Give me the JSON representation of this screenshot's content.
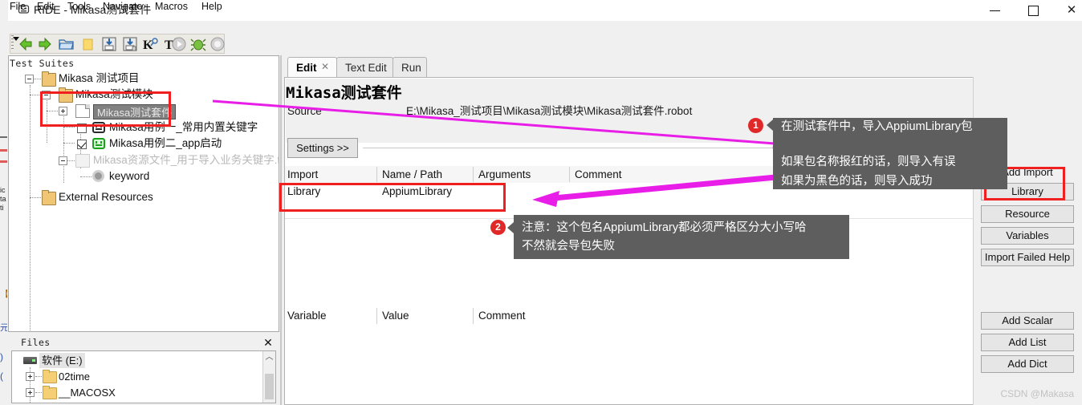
{
  "window": {
    "title": "RIDE - Mikasa测试套件",
    "minimize_label": "minimize",
    "maximize_label": "maximize",
    "close_label": "✕"
  },
  "menu": [
    {
      "label": "File"
    },
    {
      "label": "Edit"
    },
    {
      "label": "Tools"
    },
    {
      "label": "Navigate"
    },
    {
      "label": "Macros"
    },
    {
      "label": "Help"
    }
  ],
  "toolbar": {
    "icons": [
      {
        "name": "back-arrow-icon"
      },
      {
        "name": "forward-arrow-icon"
      },
      {
        "name": "open-folder-icon"
      },
      {
        "name": "new-folder-icon"
      },
      {
        "name": "save-icon"
      },
      {
        "name": "save-all-icon"
      },
      {
        "name": "search-keyword-icon",
        "label": "K"
      },
      {
        "name": "search-test-icon",
        "label": "T"
      },
      {
        "name": "run-icon"
      },
      {
        "name": "debug-icon"
      },
      {
        "name": "stop-icon"
      }
    ]
  },
  "suites_panel": {
    "title": "Test Suites",
    "tree": [
      {
        "label": "Mikasa 测试项目",
        "icon": "project-folder-icon",
        "depth": 0
      },
      {
        "label": "Mikasa测试模块",
        "icon": "project-folder-icon",
        "depth": 1
      },
      {
        "label": "Mikasa测试套件",
        "icon": "document-icon",
        "depth": 2,
        "selected": true
      },
      {
        "label": "Mikasa用例一_常用内置关键字",
        "icon": "test-case-icon",
        "depth": 3,
        "checked": false
      },
      {
        "label": "Mikasa用例二_app启动",
        "icon": "test-case-green-icon",
        "depth": 3,
        "checked": true
      },
      {
        "label": "Mikasa资源文件_用于导入业务关键字.txt",
        "icon": "resource-icon",
        "depth": 2,
        "dim": true
      },
      {
        "label": "keyword",
        "icon": "gear-icon",
        "depth": 3
      },
      {
        "label": "External Resources",
        "icon": "project-folder-icon",
        "depth": 0
      }
    ]
  },
  "files_panel": {
    "title": "Files",
    "close_label": "✕",
    "scroll_up_label": "︿",
    "items": [
      {
        "label": "软件 (E:)",
        "icon": "drive-icon",
        "depth": 0,
        "selected": true
      },
      {
        "label": "02time",
        "icon": "folder-icon",
        "depth": 1
      },
      {
        "label": "__MACOSX",
        "icon": "folder-icon",
        "depth": 1
      }
    ]
  },
  "editor": {
    "tabs": [
      {
        "label": "Edit",
        "active": true,
        "closable": true,
        "close_label": "✕"
      },
      {
        "label": "Text Edit",
        "active": false
      },
      {
        "label": "Run",
        "active": false
      }
    ],
    "suite_name": "Mikasa测试套件",
    "source_label": "Source",
    "source_path": "E:\\Mikasa_测试项目\\Mikasa测试模块\\Mikasa测试套件.robot",
    "settings_button": "Settings >>",
    "imports_table": {
      "headers": [
        "Import",
        "Name / Path",
        "Arguments",
        "Comment"
      ],
      "rows": [
        [
          "Library",
          "AppiumLibrary",
          "",
          ""
        ],
        [
          "",
          "",
          "",
          ""
        ]
      ]
    },
    "variables_table": {
      "headers": [
        "Variable",
        "Value",
        "Comment"
      ]
    }
  },
  "side_panel": {
    "add_import_title": "Add Import",
    "import_buttons": [
      {
        "label": "Library"
      },
      {
        "label": "Resource"
      },
      {
        "label": "Variables"
      },
      {
        "label": "Import Failed Help"
      }
    ],
    "variable_buttons": [
      {
        "label": "Add Scalar"
      },
      {
        "label": "Add List"
      },
      {
        "label": "Add Dict"
      }
    ],
    "watermark": "CSDN @Makasa"
  },
  "annotations": {
    "callout_1": {
      "number": "1",
      "line1": "在测试套件中，导入AppiumLibrary包",
      "line2": "如果包名称报红的话，则导入有误\n如果为黑色的话，则导入成功"
    },
    "callout_2": {
      "number": "2",
      "text": "注意：这个包名AppiumLibrary都必须严格区分大小写哈\n不然就会导包失败"
    },
    "colors": {
      "highlight_box": "#f02020",
      "arrow_magenta": "#e81ee8",
      "arrow_purple": "#7b2d8e",
      "callout_bg": "#5e5e5e",
      "bubble_bg": "#e02828"
    }
  }
}
